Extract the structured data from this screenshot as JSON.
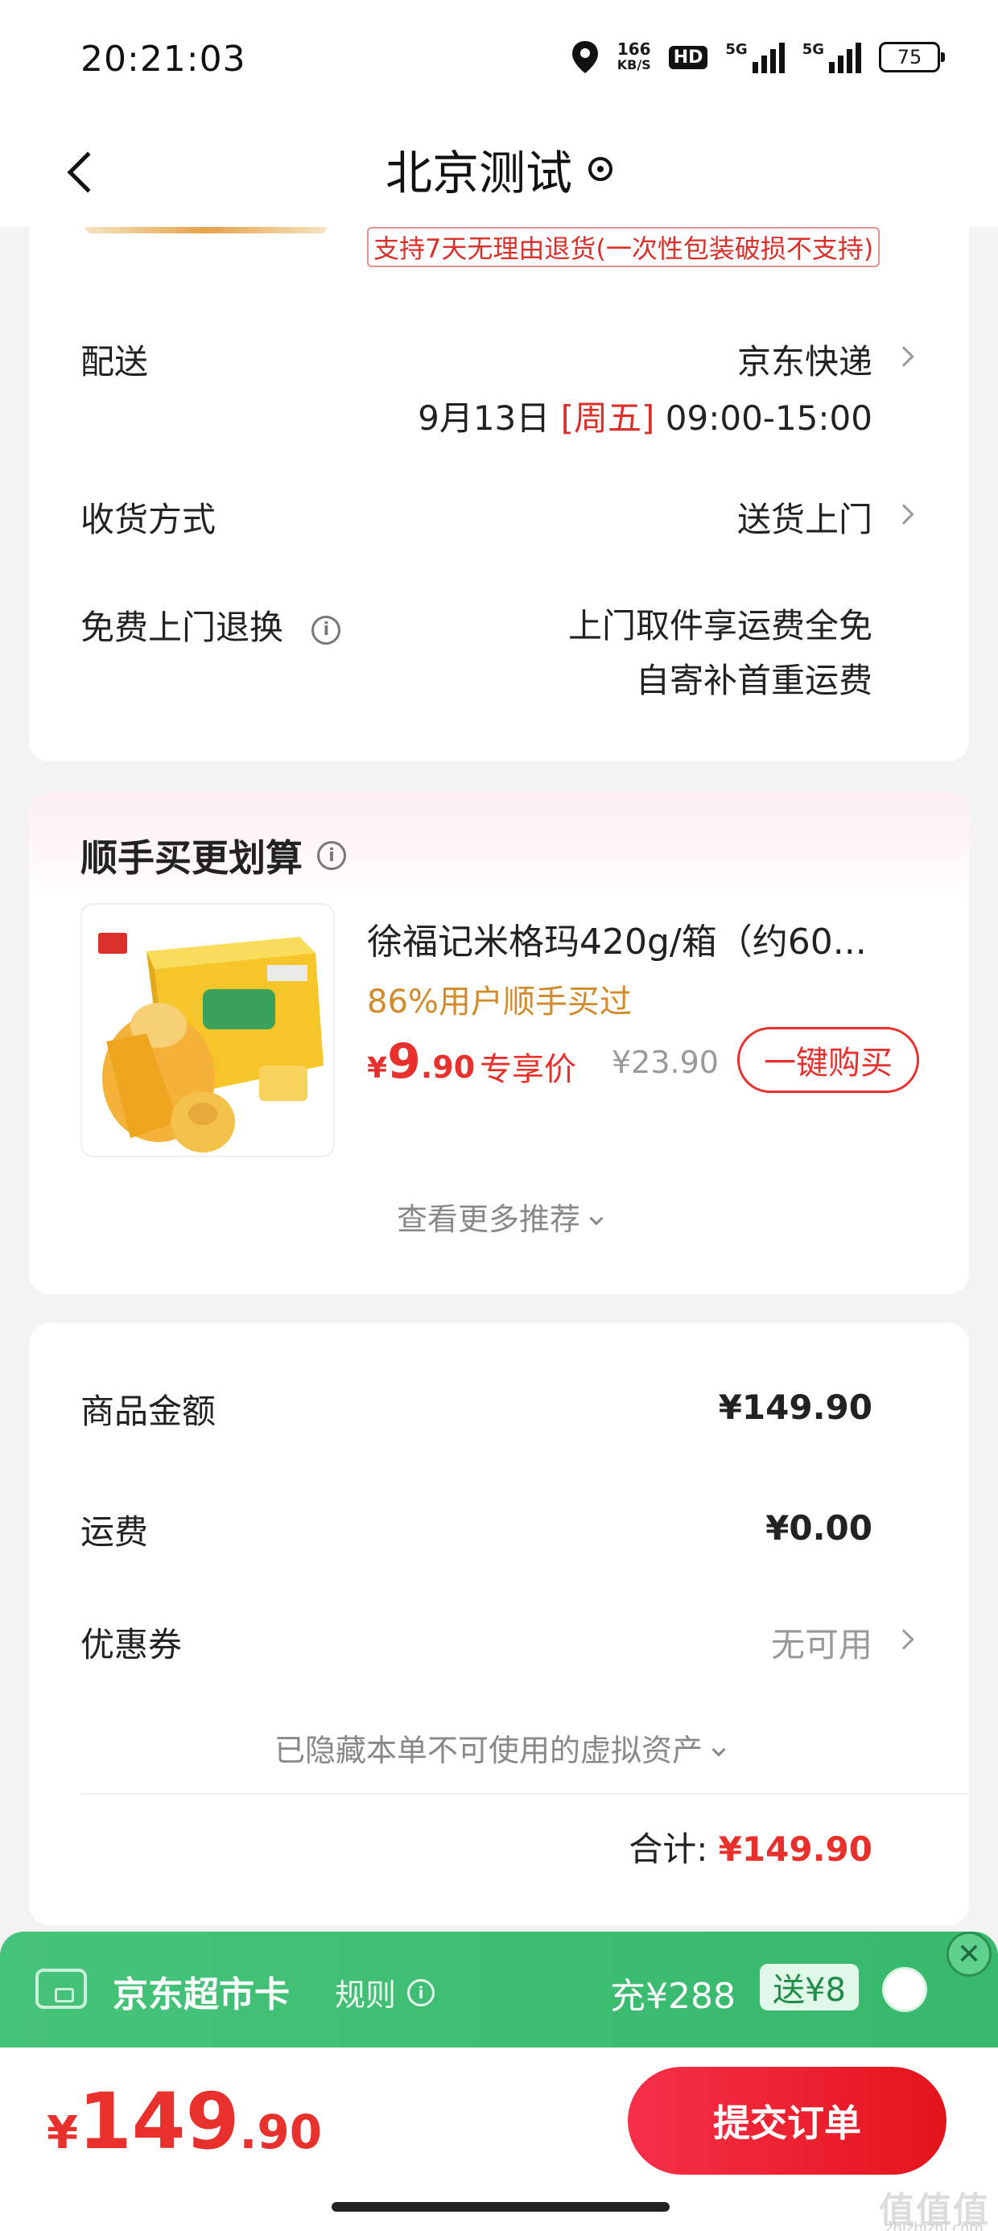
{
  "status_bar": {
    "time": "20:21:03",
    "speed_value": "166",
    "speed_unit": "KB/S",
    "hd_label": "HD",
    "sig1_label": "5G",
    "sig2_label": "5G",
    "battery": "75",
    "icons": [
      "location-icon",
      "hd-icon",
      "signal-icon",
      "battery-icon"
    ]
  },
  "header": {
    "title": "北京测试",
    "icons": [
      "back-icon",
      "location-pin-icon"
    ]
  },
  "delivery_card": {
    "return_policy": "支持7天无理由退货(一次性包装破损不支持)",
    "delivery_label": "配送",
    "delivery_value": "京东快递",
    "delivery_date": "9月13日",
    "delivery_weekday": "[周五]",
    "delivery_time": "09:00-15:00",
    "receive_label": "收货方式",
    "receive_value": "送货上门",
    "return_label": "免费上门退换",
    "return_value_line1": "上门取件享运费全免",
    "return_value_line2": "自寄补首重运费"
  },
  "recommend": {
    "title": "顺手买更划算",
    "product_name": "徐福记米格玛420g/箱（约60...",
    "buy_rate": "86%用户顺手买过",
    "price_symbol": "¥",
    "price_int": "9",
    "price_dec": ".90",
    "price_tag": "专享价",
    "original_price": "¥23.90",
    "buy_button": "一键购买",
    "more_label": "查看更多推荐"
  },
  "summary": {
    "goods_label": "商品金额",
    "goods_value": "¥149.90",
    "shipping_label": "运费",
    "shipping_value": "¥0.00",
    "coupon_label": "优惠券",
    "coupon_value": "无可用",
    "hidden_assets": "已隐藏本单不可使用的虚拟资产",
    "total_label": "合计:",
    "total_value": "¥149.90"
  },
  "supermarket_card": {
    "title": "京东超市卡",
    "rule": "规则",
    "recharge": "充¥288",
    "gift": "送¥8",
    "accent_color": "#3dbd72"
  },
  "bottom_bar": {
    "price_symbol": "¥",
    "price_int": "149",
    "price_dec": ".90",
    "submit_label": "提交订单",
    "accent_color": "#e8302c"
  },
  "watermark": {
    "text": "值值值",
    "sub": "zhizhizhi.com"
  }
}
